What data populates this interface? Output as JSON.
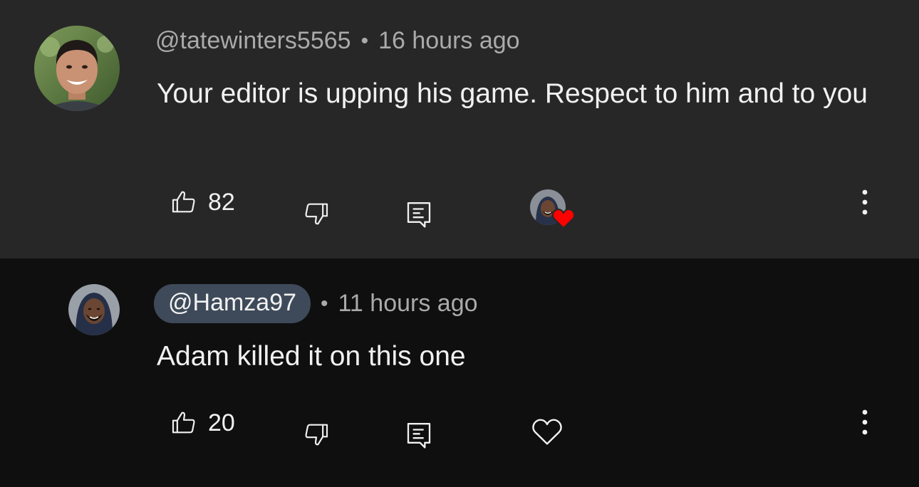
{
  "comments": [
    {
      "handle": "@tatewinters5565",
      "separator": "•",
      "time": "16 hours ago",
      "text": "Your editor is upping his game. Respect to him and to you",
      "likes": "82",
      "creator_hearted": true
    },
    {
      "handle": "@Hamza97",
      "separator": "•",
      "time": "11 hours ago",
      "text": "Adam killed it on this one",
      "likes": "20",
      "creator_hearted": false
    }
  ],
  "colors": {
    "highlight_bg": "#272727",
    "page_bg": "#0f0f0f",
    "text": "#f1f1f1",
    "meta_text": "#aaaaaa",
    "creator_chip": "#3e4a59",
    "heart": "#ff0000"
  },
  "icons": [
    "like-icon",
    "dislike-icon",
    "reply-icon",
    "creator-heart-icon",
    "heart-outline-icon",
    "more-vert-icon"
  ]
}
